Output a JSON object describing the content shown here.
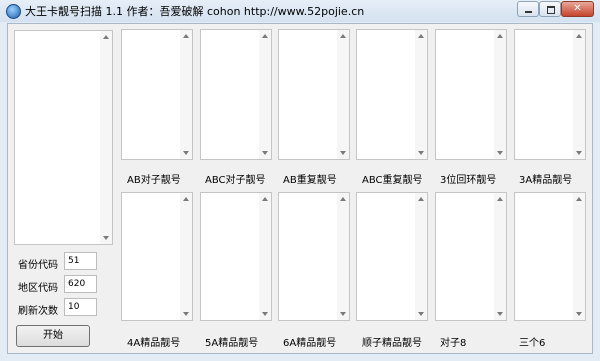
{
  "window": {
    "title": "大王卡靓号扫描 1.1  作者：吾爱破解 cohon    http://www.52pojie.cn",
    "close_glyph": "✕"
  },
  "result_lists": [
    {
      "label": "AB对子靓号"
    },
    {
      "label": "ABC对子靓号"
    },
    {
      "label": "AB重复靓号"
    },
    {
      "label": "ABC重复靓号"
    },
    {
      "label": "3位回环靓号"
    },
    {
      "label": "3A精品靓号"
    },
    {
      "label": "4A精品靓号"
    },
    {
      "label": "5A精品靓号"
    },
    {
      "label": "6A精品靓号"
    },
    {
      "label": "顺子精品靓号"
    },
    {
      "label": "对子8"
    },
    {
      "label": "三个6"
    }
  ],
  "form": {
    "province_label": "省份代码",
    "province_value": "51",
    "area_label": "地区代码",
    "area_value": "620",
    "refresh_label": "刷新次数",
    "refresh_value": "10",
    "start_label": "开始"
  }
}
